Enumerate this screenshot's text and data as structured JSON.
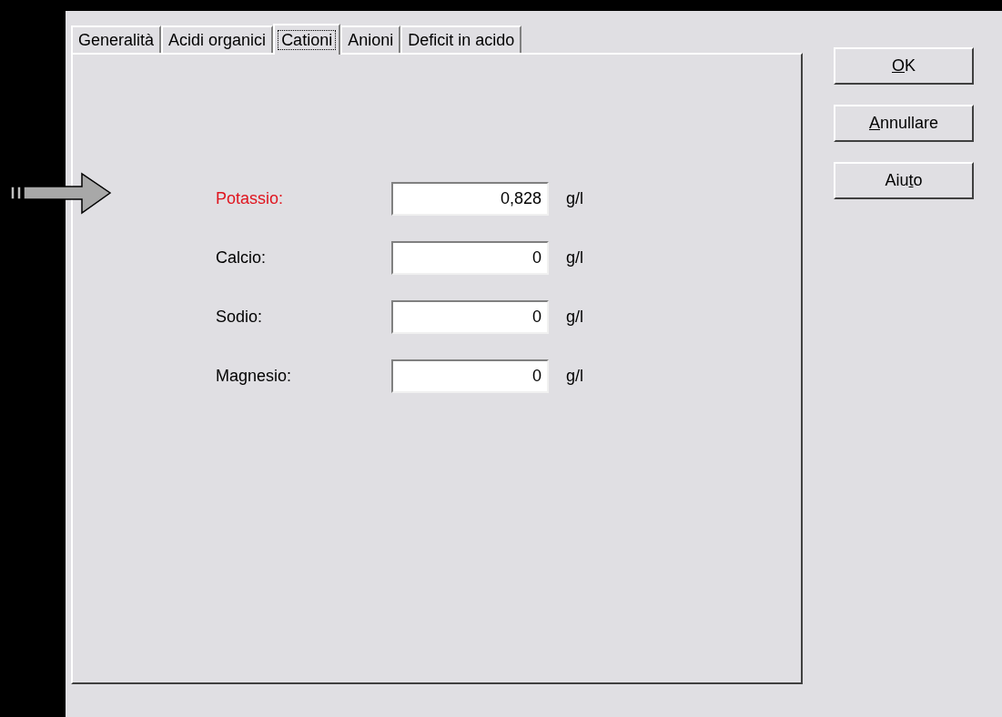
{
  "tabs": [
    {
      "label": "Generalità",
      "selected": false
    },
    {
      "label": "Acidi organici",
      "selected": false
    },
    {
      "label": "Cationi",
      "selected": true
    },
    {
      "label": "Anioni",
      "selected": false
    },
    {
      "label": "Deficit in acido",
      "selected": false
    }
  ],
  "fields": [
    {
      "label": "Potassio:",
      "highlighted": true,
      "value": "0,828",
      "unit": "g/l"
    },
    {
      "label": "Calcio:",
      "highlighted": false,
      "value": "0",
      "unit": "g/l"
    },
    {
      "label": "Sodio:",
      "highlighted": false,
      "value": "0",
      "unit": "g/l"
    },
    {
      "label": "Magnesio:",
      "highlighted": false,
      "value": "0",
      "unit": "g/l"
    }
  ],
  "buttons": [
    {
      "key": "O",
      "after": "K"
    },
    {
      "key": "A",
      "after": "nnullare"
    },
    {
      "before": "Aiu",
      "key": "t",
      "after": "o"
    }
  ]
}
